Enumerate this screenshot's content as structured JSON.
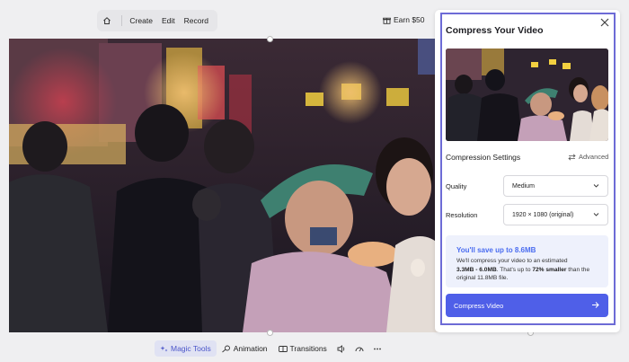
{
  "nav": {
    "items": [
      "Create",
      "Edit",
      "Record"
    ],
    "earn_label": "Earn $50"
  },
  "toolbar": {
    "magic_tools": "Magic Tools",
    "animation": "Animation",
    "transitions": "Transitions"
  },
  "panel": {
    "title": "Compress Your Video",
    "settings_title": "Compression Settings",
    "advanced_label": "Advanced",
    "quality_label": "Quality",
    "quality_value": "Medium",
    "resolution_label": "Resolution",
    "resolution_value": "1920 × 1080 (original)",
    "savings_title": "You'll save up to 8.6MB",
    "savings_text_1": "We'll compress your video to an estimated",
    "savings_range": "3.3MB - 6.0MB",
    "savings_text_2": ". That's up to ",
    "savings_percent": "72% smaller",
    "savings_text_3": " than the original 11.8MB file.",
    "compress_button": "Compress Video"
  },
  "colors": {
    "accent": "#4f5fe8",
    "savings_title": "#4a6cf0",
    "savings_bg": "#eef1fc",
    "frame": "#6d6bd6",
    "active_tool": "#4a55c9"
  },
  "icons": {
    "home": "home-icon",
    "earn": "gift-icon",
    "close": "close-icon",
    "advanced": "swap-icon",
    "magic": "sparkle-icon",
    "animation": "animation-icon",
    "transitions": "transitions-icon",
    "volume": "volume-icon",
    "speed": "speed-icon",
    "more": "more-icon"
  }
}
